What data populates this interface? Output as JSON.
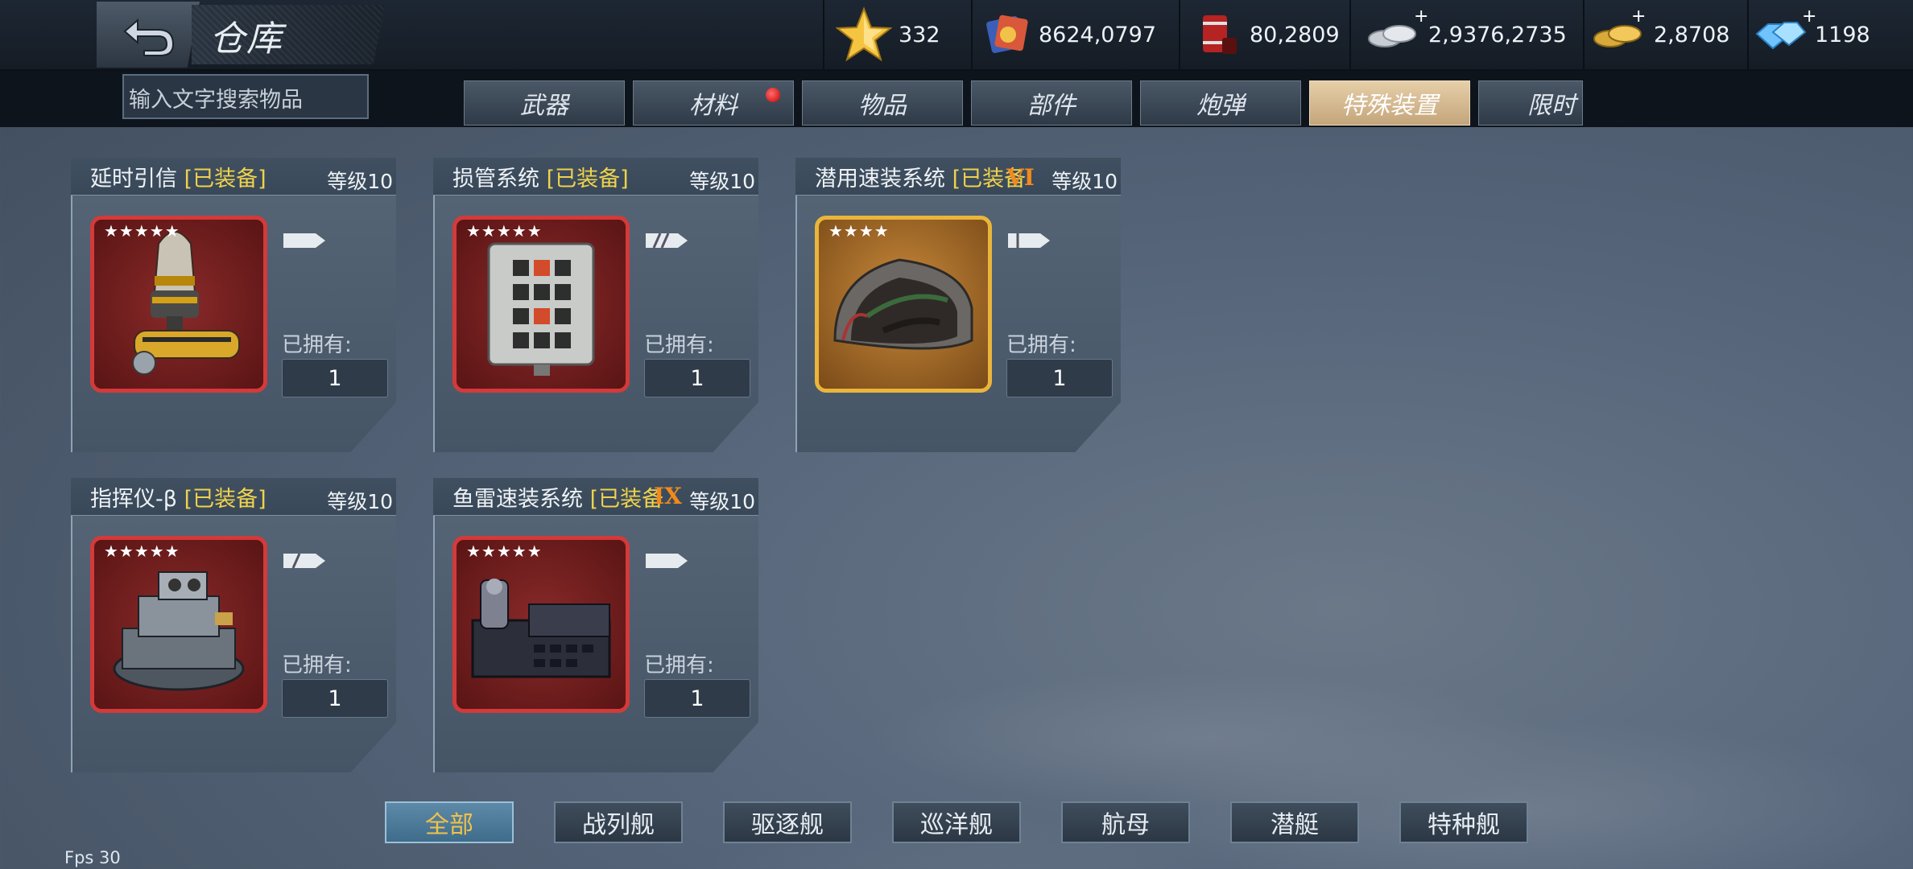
{
  "header": {
    "title": "仓库",
    "back_icon": "back-arrow-icon"
  },
  "resources": [
    {
      "name": "star-icon",
      "value": "332"
    },
    {
      "name": "medal-icon",
      "value": "8624,0797"
    },
    {
      "name": "fuel-barrel-icon",
      "value": "80,2809"
    },
    {
      "name": "silver-coins-icon",
      "value": "2,9376,2735",
      "plus": "+"
    },
    {
      "name": "gold-coins-icon",
      "value": "2,8708",
      "plus": "+"
    },
    {
      "name": "diamond-icon",
      "value": "1198",
      "plus": "+"
    }
  ],
  "search": {
    "placeholder": "输入文字搜索物品"
  },
  "tabs": [
    "武器",
    "材料",
    "物品",
    "部件",
    "炮弹",
    "特殊装置",
    "限时"
  ],
  "active_tab": "特殊装置",
  "cards": [
    {
      "name": "延时引信",
      "equipped": "[已装备]",
      "roman": "",
      "level": "等级10",
      "stars": "★★★★★",
      "owned_label": "已拥有:",
      "owned": "1",
      "icon": "fuse-icon"
    },
    {
      "name": "损管系统",
      "equipped": "[已装备]",
      "roman": "",
      "level": "等级10",
      "stars": "★★★★★",
      "owned_label": "已拥有:",
      "owned": "1",
      "icon": "control-panel-icon"
    },
    {
      "name": "潜用速装系统",
      "equipped": "[已装备",
      "roman": "VI",
      "level": "等级10",
      "stars": "★★★★",
      "owned_label": "已拥有:",
      "owned": "1",
      "icon": "torpedo-tube-icon"
    },
    {
      "name": "指挥仪-β",
      "equipped": "[已装备]",
      "roman": "",
      "level": "等级10",
      "stars": "★★★★★",
      "owned_label": "已拥有:",
      "owned": "1",
      "icon": "director-icon"
    },
    {
      "name": "鱼雷速装系统",
      "equipped": "[已装备",
      "roman": "IX",
      "level": "等级10",
      "stars": "★★★★★",
      "owned_label": "已拥有:",
      "owned": "1",
      "icon": "torpedo-launcher-icon"
    }
  ],
  "filters": [
    "全部",
    "战列舰",
    "驱逐舰",
    "巡洋舰",
    "航母",
    "潜艇",
    "特种舰"
  ],
  "active_filter": "全部",
  "fps": "Fps 30"
}
